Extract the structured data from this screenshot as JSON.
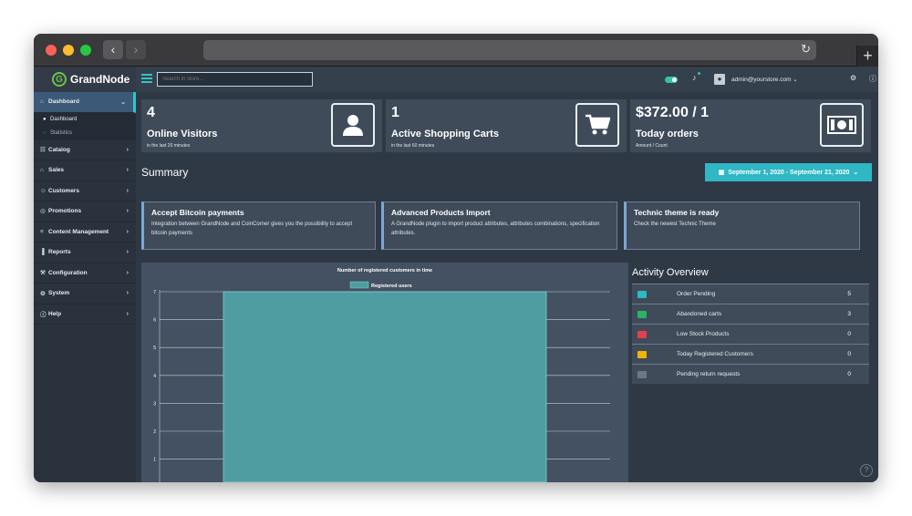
{
  "sidebar": {
    "logo_text": "GrandNode",
    "items": [
      {
        "label": "Dashboard",
        "icon": "home-icon"
      },
      {
        "label": "Catalog",
        "icon": "sitemap-icon"
      },
      {
        "label": "Sales",
        "icon": "cart-icon"
      },
      {
        "label": "Customers",
        "icon": "users-icon"
      },
      {
        "label": "Promotions",
        "icon": "lightbulb-icon"
      },
      {
        "label": "Content Management",
        "icon": "database-icon"
      },
      {
        "label": "Reports",
        "icon": "bar-chart-icon"
      },
      {
        "label": "Configuration",
        "icon": "wrench-icon"
      },
      {
        "label": "System",
        "icon": "gear-icon"
      },
      {
        "label": "Help",
        "icon": "question-icon"
      }
    ],
    "sub_items": [
      {
        "label": "Dashboard"
      },
      {
        "label": "Statistics"
      }
    ]
  },
  "topbar": {
    "search_placeholder": "Search in store...",
    "user": "admin@yourstore.com"
  },
  "stats": [
    {
      "value": "4",
      "title": "Online Visitors",
      "sub": "in the last 20 minutes",
      "icon": "user-icon"
    },
    {
      "value": "1",
      "title": "Active Shopping Carts",
      "sub": "in the last 60 minutes",
      "icon": "shopping-cart-icon"
    },
    {
      "value": "$372.00 / 1",
      "title": "Today orders",
      "sub": "Amount / Count",
      "icon": "money-bill-icon"
    }
  ],
  "summary": {
    "title": "Summary",
    "date_range": "September 1, 2020 - September 21, 2020"
  },
  "cards": [
    {
      "title": "Accept Bitcoin payments",
      "desc": "Integration between GrandNode and CoinCorner gives you the possibility to accept bitcoin payments"
    },
    {
      "title": "Advanced Products Import",
      "desc": "A GrandNode plugin to import product attributes, attributes combinations, specification attributes."
    },
    {
      "title": "Technic theme is ready",
      "desc": "Check the newest Technic Theme"
    }
  ],
  "chart_data": {
    "type": "bar",
    "title": "Number of registered customers in time",
    "categories": [
      ""
    ],
    "series": [
      {
        "name": "Registered users",
        "values": [
          7
        ]
      }
    ],
    "ylim": [
      0,
      7
    ],
    "yticks": [
      "1",
      "2",
      "3",
      "4",
      "5",
      "6",
      "7"
    ],
    "grid": true,
    "legend": "top",
    "colors": {
      "bar_fill": "#4f9da0",
      "bar_border": "#7fd1d1"
    }
  },
  "activity": {
    "title": "Activity Overview",
    "rows": [
      {
        "label": "Order Pending",
        "value": "5",
        "color": "#2fb7c4"
      },
      {
        "label": "Abandoned carts",
        "value": "3",
        "color": "#28b463"
      },
      {
        "label": "Low Stock Products",
        "value": "0",
        "color": "#e53e4f"
      },
      {
        "label": "Today Registered Customers",
        "value": "0",
        "color": "#f0b400"
      },
      {
        "label": "Pending return requests",
        "value": "0",
        "color": "#6d7885"
      }
    ]
  }
}
